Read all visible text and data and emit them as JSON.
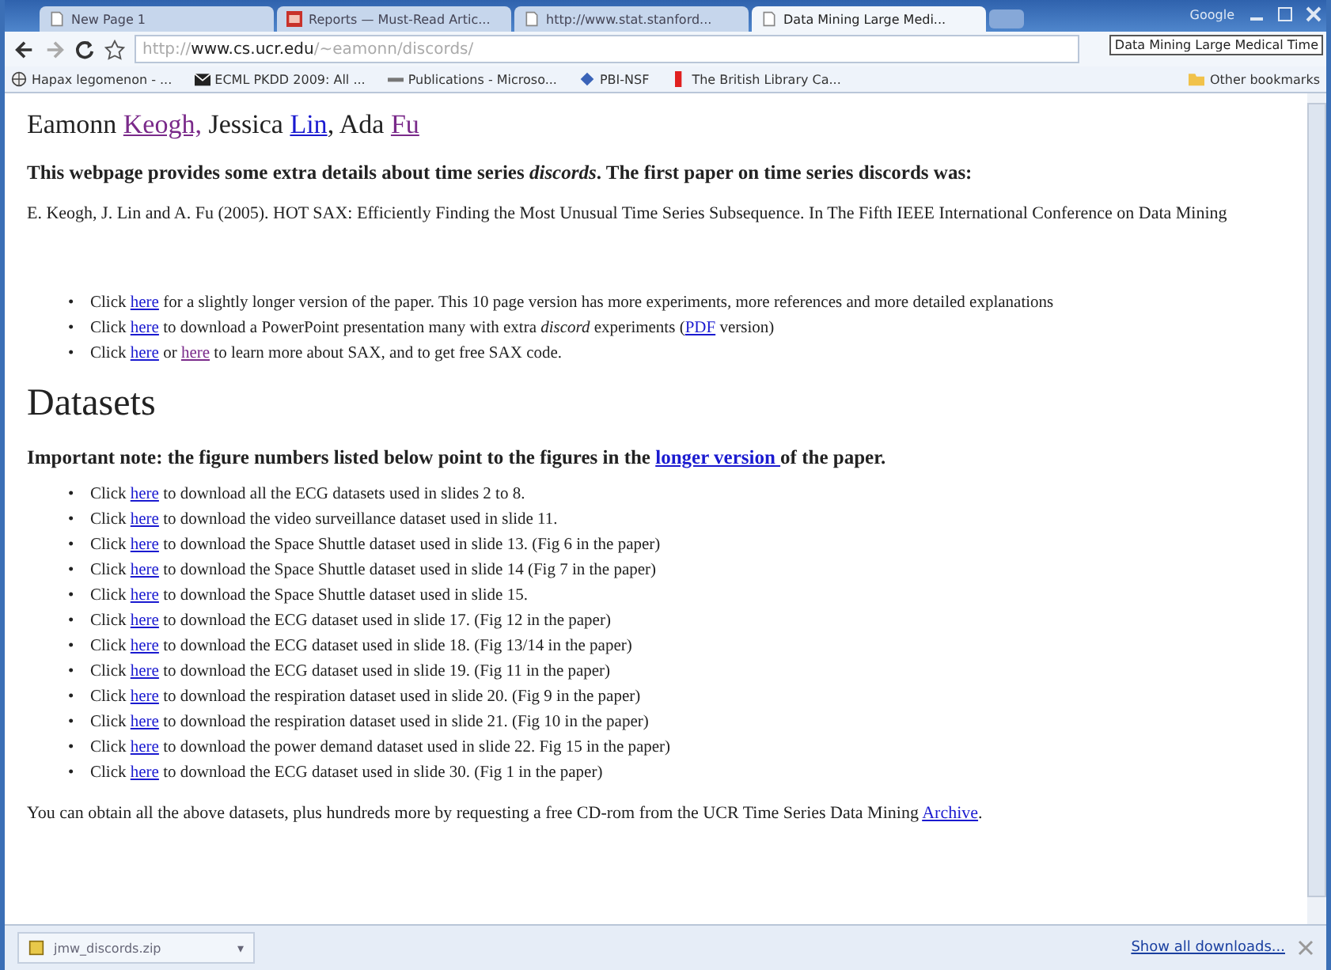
{
  "window": {
    "controls": [
      "Google"
    ]
  },
  "tabs": [
    {
      "title": "New Page 1",
      "selected": false,
      "kind": "page"
    },
    {
      "title": "Reports — Must-Read Artic...",
      "selected": false,
      "kind": "report"
    },
    {
      "title": "http://www.stat.stanford...",
      "selected": false,
      "kind": "page"
    },
    {
      "title": "Data Mining Large Medi...",
      "selected": true,
      "kind": "page"
    }
  ],
  "tooltip": "Data Mining Large Medical Time",
  "address": {
    "scheme": "http://",
    "host": "www.cs.ucr.edu",
    "path": "/~eamonn/discords/"
  },
  "bookmarks": [
    {
      "label": "Hapax legomenon - ...",
      "kind": "wiki"
    },
    {
      "label": "ECML PKDD 2009: All ...",
      "kind": "mail"
    },
    {
      "label": "Publications - Microso...",
      "kind": "pub"
    },
    {
      "label": "PBI-NSF",
      "kind": "diamond"
    },
    {
      "label": "The British Library Ca...",
      "kind": "flag"
    }
  ],
  "other_bookmarks": "Other bookmarks",
  "page": {
    "authors": [
      {
        "text": "Eamonn ",
        "kind": "text"
      },
      {
        "text": "Keogh,",
        "kind": "link",
        "visited": true
      },
      {
        "text": " Jessica ",
        "kind": "text"
      },
      {
        "text": "Lin",
        "kind": "link",
        "visited": false
      },
      {
        "text": ", Ada ",
        "kind": "text"
      },
      {
        "text": "Fu",
        "kind": "link",
        "visited": true
      }
    ],
    "intro": "This webpage provides some extra details about time series *discords*. The first paper on time series discords was:",
    "reference": "E. Keogh, J. Lin and A. Fu (2005). HOT SAX: Efficiently Finding the Most Unusual Time Series Subsequence. In The Fifth IEEE International Conference on Data Mining",
    "links": [
      {
        "bullet": "•",
        "parts": [
          {
            "text": "Click ",
            "kind": "text"
          },
          {
            "text": "here",
            "kind": "link",
            "visited": false
          },
          {
            "text": " for a slightly longer version of the paper. This 10 page version has more experiments, more references and more detailed explanations",
            "kind": "text"
          }
        ]
      },
      {
        "bullet": "•",
        "parts": [
          {
            "text": "Click ",
            "kind": "text"
          },
          {
            "text": "here",
            "kind": "link",
            "visited": false
          },
          {
            "text": " to download a PowerPoint presentation many with extra ",
            "kind": "text"
          },
          {
            "text": "discord",
            "kind": "italic"
          },
          {
            "text": " experiments (",
            "kind": "text"
          },
          {
            "text": "PDF",
            "kind": "link",
            "visited": false
          },
          {
            "text": " version)",
            "kind": "text"
          }
        ]
      },
      {
        "bullet": "•",
        "parts": [
          {
            "text": "Click ",
            "kind": "text"
          },
          {
            "text": "here",
            "kind": "link",
            "visited": false
          },
          {
            "text": " or ",
            "kind": "text"
          },
          {
            "text": "here",
            "kind": "link",
            "visited": true
          },
          {
            "text": " to learn more about SAX, and to get free SAX code.",
            "kind": "text"
          }
        ]
      }
    ],
    "heading": "Datasets",
    "note": [
      {
        "text": "Important note: the figure numbers listed below point to the figures in the ",
        "kind": "text"
      },
      {
        "text": "longer version ",
        "kind": "link",
        "visited": false
      },
      {
        "text": "of the paper.",
        "kind": "text"
      }
    ],
    "datasets": [
      {
        "bullet": "•",
        "click": "Click",
        "link": "here",
        "text": "to download all the ECG datasets used in slides 2 to 8."
      },
      {
        "bullet": "•",
        "click": "Click",
        "link": "here",
        "text": "to download the video surveillance dataset used in slide 11."
      },
      {
        "bullet": "•",
        "click": "Click",
        "link": "here",
        "text": "to download the Space Shuttle dataset used in slide 13. (Fig 6 in the paper)"
      },
      {
        "bullet": "•",
        "click": "Click",
        "link": "here",
        "text": "to download the Space Shuttle dataset used in slide 14 (Fig 7 in the paper)"
      },
      {
        "bullet": "•",
        "click": "Click",
        "link": "here",
        "text": "to download the Space Shuttle dataset used in slide 15."
      },
      {
        "bullet": "•",
        "click": "Click",
        "link": "here",
        "text": "to download the ECG dataset used in slide 17. (Fig 12 in the paper)"
      },
      {
        "bullet": "•",
        "click": "Click",
        "link": "here",
        "text": "to download the ECG dataset used in slide 18. (Fig 13/14 in the paper)"
      },
      {
        "bullet": "•",
        "click": "Click",
        "link": "here",
        "text": "to download the ECG dataset used in slide 19. (Fig 11 in the paper)"
      },
      {
        "bullet": "•",
        "click": "Click",
        "link": "here",
        "text": "to download the respiration dataset used in slide 20. (Fig 9 in the paper)"
      },
      {
        "bullet": "•",
        "click": "Click",
        "link": "here",
        "text": "to download the respiration dataset used in slide 21. (Fig 10 in the paper)"
      },
      {
        "bullet": "•",
        "click": "Click",
        "link": "here",
        "text": "to download the power demand dataset used in slide 22. Fig 15 in the paper)"
      },
      {
        "bullet": "•",
        "click": "Click",
        "link": "here",
        "text": "to download the ECG dataset used in slide 30. (Fig 1 in the paper)"
      }
    ],
    "footer": [
      {
        "text": "You can obtain all the above datasets, plus hundreds more by requesting a free CD-rom from the UCR Time Series Data Mining ",
        "kind": "text"
      },
      {
        "text": "Archive",
        "kind": "link",
        "visited": false
      },
      {
        "text": ".",
        "kind": "text"
      }
    ]
  },
  "download": {
    "file": "jmw_discords.zip",
    "menu": "▾",
    "show_all": "Show all downloads..."
  }
}
